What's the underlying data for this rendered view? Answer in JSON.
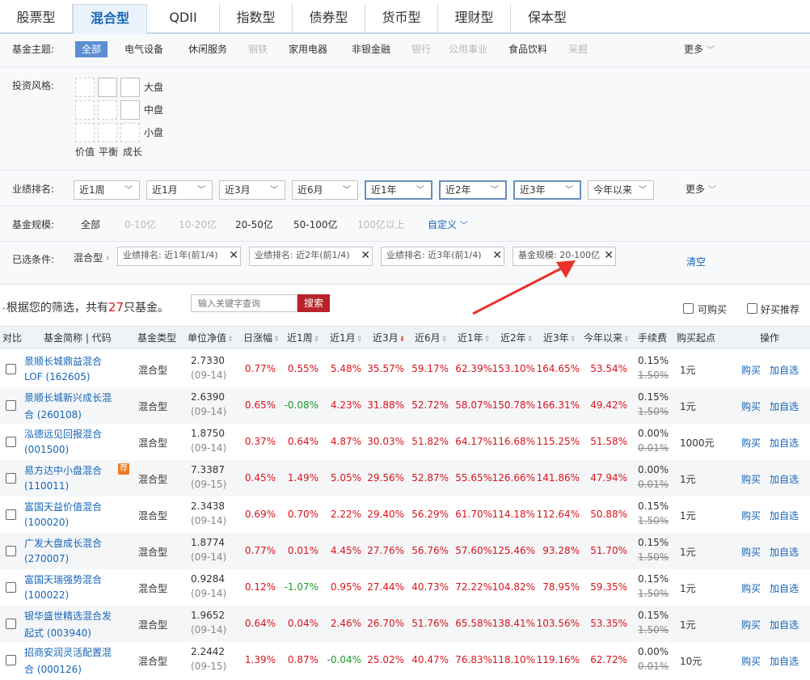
{
  "tabs": [
    "股票型",
    "混合型",
    "QDII",
    "指数型",
    "债券型",
    "货币型",
    "理财型",
    "保本型"
  ],
  "active_tab": 1,
  "theme": {
    "label": "基金主题:",
    "options": [
      {
        "text": "全部",
        "state": "sel"
      },
      {
        "text": "电气设备",
        "state": "norm"
      },
      {
        "text": "休闲服务",
        "state": "norm"
      },
      {
        "text": "钢铁",
        "state": "dis"
      },
      {
        "text": "家用电器",
        "state": "norm"
      },
      {
        "text": "非银金融",
        "state": "norm"
      },
      {
        "text": "银行",
        "state": "dis"
      },
      {
        "text": "公用事业",
        "state": "dis"
      },
      {
        "text": "食品饮料",
        "state": "norm"
      },
      {
        "text": "采掘",
        "state": "dis"
      }
    ],
    "more": "更多"
  },
  "style": {
    "label": "投资风格:",
    "size_labels": [
      "大盘",
      "中盘",
      "小盘"
    ],
    "style_labels": [
      "价值",
      "平衡",
      "成长"
    ]
  },
  "performance": {
    "label": "业绩排名:",
    "dropdowns": [
      "近1周",
      "近1月",
      "近3月",
      "近6月",
      "近1年",
      "近2年",
      "近3年",
      "今年以来"
    ],
    "more": "更多"
  },
  "scale": {
    "label": "基金规模:",
    "options": [
      {
        "text": "全部",
        "state": "norm"
      },
      {
        "text": "0-10亿",
        "state": "dis"
      },
      {
        "text": "10-20亿",
        "state": "dis"
      },
      {
        "text": "20-50亿",
        "state": "norm"
      },
      {
        "text": "50-100亿",
        "state": "norm"
      },
      {
        "text": "100亿以上",
        "state": "dis"
      }
    ],
    "custom": "自定义"
  },
  "selected": {
    "label": "已选条件:",
    "type_crumb": "混合型",
    "chips": [
      "业绩排名: 近1年(前1/4)",
      "业绩排名: 近2年(前1/4)",
      "业绩排名: 近3年(前1/4)",
      "基金规模: 20-100亿"
    ],
    "clear": "清空"
  },
  "result": {
    "prefix": "根据您的筛选，共有",
    "count": "27",
    "suffix": "只基金。",
    "search_placeholder": "输入关键字查询",
    "search_button": "搜索",
    "check_buyable": "可购买",
    "check_recommend": "好买推荐"
  },
  "table": {
    "headers": [
      "对比",
      "基金简称 | 代码",
      "基金类型",
      "单位净值",
      "日涨幅",
      "近1周",
      "近1月",
      "近3月",
      "近6月",
      "近1年",
      "近2年",
      "近3年",
      "今年以来",
      "手续费",
      "购买起点",
      "操作"
    ],
    "buy_label": "购买",
    "watch_label": "加自选",
    "rows": [
      {
        "name1": "景顺长城鼎益混合",
        "name2": "LOF (162605)",
        "type": "混合型",
        "nav": "2.7330",
        "date": "(09-14)",
        "day": "0.77%",
        "w1": "0.55%",
        "m1": "5.48%",
        "m3": "35.57%",
        "m6": "59.17%",
        "y1": "62.39%",
        "y2": "153.10%",
        "y3": "164.65%",
        "ytd": "53.54%",
        "fee": "0.15%",
        "fee_old": "1.50%",
        "start": "1元"
      },
      {
        "name1": "景顺长城新兴成长混",
        "name2": "合 (260108)",
        "type": "混合型",
        "nav": "2.6390",
        "date": "(09-14)",
        "day": "0.65%",
        "w1": "-0.08%",
        "m1": "4.23%",
        "m3": "31.88%",
        "m6": "52.72%",
        "y1": "58.07%",
        "y2": "150.78%",
        "y3": "166.31%",
        "ytd": "49.42%",
        "fee": "0.15%",
        "fee_old": "1.50%",
        "start": "1元"
      },
      {
        "name1": "泓德远见回报混合",
        "name2": "(001500)",
        "type": "混合型",
        "nav": "1.8750",
        "date": "(09-14)",
        "day": "0.37%",
        "w1": "0.64%",
        "m1": "4.87%",
        "m3": "30.03%",
        "m6": "51.82%",
        "y1": "64.17%",
        "y2": "116.68%",
        "y3": "115.25%",
        "ytd": "51.58%",
        "fee": "0.00%",
        "fee_old": "0.01%",
        "start": "1000元"
      },
      {
        "name1": "易方达中小盘混合",
        "name2": "(110011)",
        "tag": "荐",
        "type": "混合型",
        "nav": "7.3387",
        "date": "(09-15)",
        "day": "0.45%",
        "w1": "1.49%",
        "m1": "5.05%",
        "m3": "29.56%",
        "m6": "52.87%",
        "y1": "55.65%",
        "y2": "126.66%",
        "y3": "141.86%",
        "ytd": "47.94%",
        "fee": "0.00%",
        "fee_old": "0.01%",
        "start": "1元"
      },
      {
        "name1": "富国天益价值混合",
        "name2": "(100020)",
        "type": "混合型",
        "nav": "2.3438",
        "date": "(09-14)",
        "day": "0.69%",
        "w1": "0.70%",
        "m1": "2.22%",
        "m3": "29.40%",
        "m6": "56.29%",
        "y1": "61.70%",
        "y2": "114.18%",
        "y3": "112.64%",
        "ytd": "50.88%",
        "fee": "0.15%",
        "fee_old": "1.50%",
        "start": "1元"
      },
      {
        "name1": "广发大盘成长混合",
        "name2": "(270007)",
        "type": "混合型",
        "nav": "1.8774",
        "date": "(09-14)",
        "day": "0.77%",
        "w1": "0.01%",
        "m1": "4.45%",
        "m3": "27.76%",
        "m6": "56.76%",
        "y1": "57.60%",
        "y2": "125.46%",
        "y3": "93.28%",
        "ytd": "51.70%",
        "fee": "0.15%",
        "fee_old": "1.50%",
        "start": "1元"
      },
      {
        "name1": "富国天瑞强势混合",
        "name2": "(100022)",
        "type": "混合型",
        "nav": "0.9284",
        "date": "(09-14)",
        "day": "0.12%",
        "w1": "-1.07%",
        "m1": "0.95%",
        "m3": "27.44%",
        "m6": "40.73%",
        "y1": "72.22%",
        "y2": "104.82%",
        "y3": "78.95%",
        "ytd": "59.35%",
        "fee": "0.15%",
        "fee_old": "1.50%",
        "start": "1元"
      },
      {
        "name1": "银华盛世精选混合发",
        "name2": "起式 (003940)",
        "type": "混合型",
        "nav": "1.9652",
        "date": "(09-14)",
        "day": "0.64%",
        "w1": "0.04%",
        "m1": "2.46%",
        "m3": "26.70%",
        "m6": "51.76%",
        "y1": "65.58%",
        "y2": "138.41%",
        "y3": "103.56%",
        "ytd": "53.35%",
        "fee": "0.15%",
        "fee_old": "1.50%",
        "start": "1元"
      },
      {
        "name1": "招商安润灵活配置混",
        "name2": "合 (000126)",
        "type": "混合型",
        "nav": "2.2442",
        "date": "(09-15)",
        "day": "1.39%",
        "w1": "0.87%",
        "m1": "-0.04%",
        "m3": "25.02%",
        "m6": "40.47%",
        "y1": "76.83%",
        "y2": "118.10%",
        "y3": "119.16%",
        "ytd": "62.72%",
        "fee": "0.00%",
        "fee_old": "0.01%",
        "start": "10元"
      }
    ]
  },
  "colors": {
    "accent": "#1565b8",
    "up": "#d8141c",
    "down": "#1a9b2b",
    "search_btn": "#b8222a"
  }
}
